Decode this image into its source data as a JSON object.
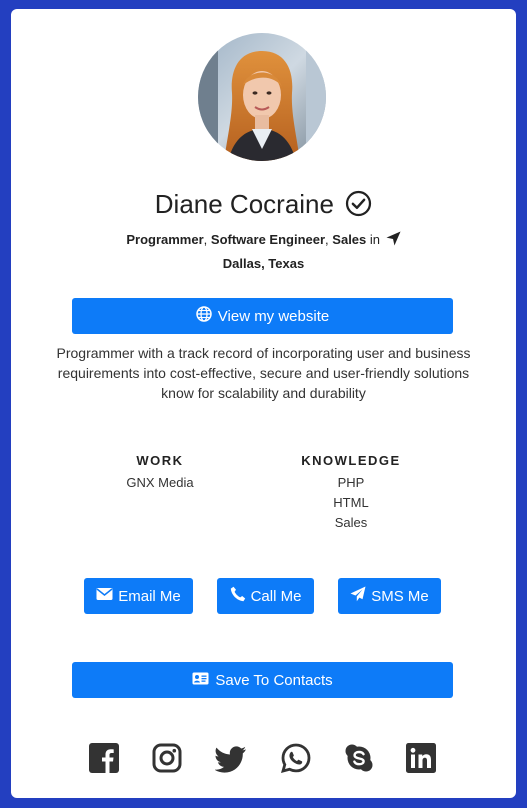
{
  "profile": {
    "name": "Diane Cocraine",
    "roles": [
      "Programmer",
      "Software Engineer",
      "Sales"
    ],
    "role_separator": ",",
    "in_text": "in",
    "location": "Dallas, Texas",
    "bio": "Programmer with a track record of incorporating user and business requirements into cost-effective, secure and user-friendly solutions know for scalability and durability"
  },
  "buttons": {
    "website": "View my website",
    "email": "Email Me",
    "call": "Call Me",
    "sms": "SMS Me",
    "save": "Save To Contacts"
  },
  "work": {
    "heading": "WORK",
    "items": [
      "GNX Media"
    ]
  },
  "knowledge": {
    "heading": "KNOWLEDGE",
    "items": [
      "PHP",
      "HTML",
      "Sales"
    ]
  },
  "social": [
    "facebook-icon",
    "instagram-icon",
    "twitter-icon",
    "whatsapp-icon",
    "skype-icon",
    "linkedin-icon"
  ],
  "colors": {
    "background": "#233fc0",
    "card": "#ffffff",
    "primary_button": "#0d7bf8",
    "social_icon": "#333333"
  }
}
